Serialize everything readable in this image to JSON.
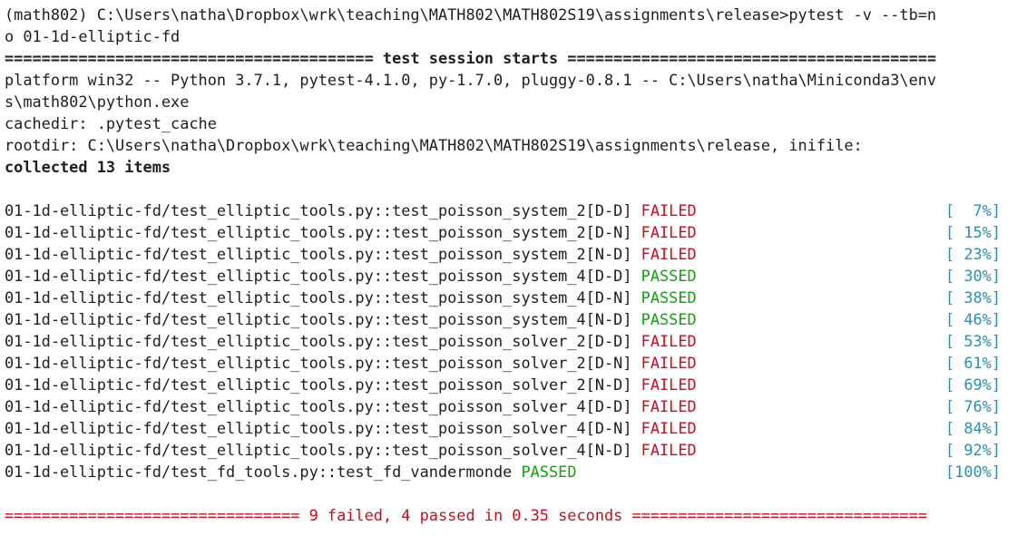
{
  "terminal": {
    "command_line_1": "(math802) C:\\Users\\natha\\Dropbox\\wrk\\teaching\\MATH802\\MATH802S19\\assignments\\release>pytest -v --tb=n",
    "command_line_2": "o 01-1d-elliptic-fd",
    "session_banner": "======================================== test session starts ========================================",
    "platform_line_1": "platform win32 -- Python 3.7.1, pytest-4.1.0, py-1.7.0, pluggy-0.8.1 -- C:\\Users\\natha\\Miniconda3\\env",
    "platform_line_2": "s\\math802\\python.exe",
    "cachedir_line": "cachedir: .pytest_cache",
    "rootdir_line": "rootdir: C:\\Users\\natha\\Dropbox\\wrk\\teaching\\MATH802\\MATH802S19\\assignments\\release, inifile:",
    "collected_line": "collected 13 items",
    "tests": [
      {
        "name": "01-1d-elliptic-fd/test_elliptic_tools.py::test_poisson_system_2[D-D]",
        "status": "FAILED",
        "progress": "[  7%]"
      },
      {
        "name": "01-1d-elliptic-fd/test_elliptic_tools.py::test_poisson_system_2[D-N]",
        "status": "FAILED",
        "progress": "[ 15%]"
      },
      {
        "name": "01-1d-elliptic-fd/test_elliptic_tools.py::test_poisson_system_2[N-D]",
        "status": "FAILED",
        "progress": "[ 23%]"
      },
      {
        "name": "01-1d-elliptic-fd/test_elliptic_tools.py::test_poisson_system_4[D-D]",
        "status": "PASSED",
        "progress": "[ 30%]"
      },
      {
        "name": "01-1d-elliptic-fd/test_elliptic_tools.py::test_poisson_system_4[D-N]",
        "status": "PASSED",
        "progress": "[ 38%]"
      },
      {
        "name": "01-1d-elliptic-fd/test_elliptic_tools.py::test_poisson_system_4[N-D]",
        "status": "PASSED",
        "progress": "[ 46%]"
      },
      {
        "name": "01-1d-elliptic-fd/test_elliptic_tools.py::test_poisson_solver_2[D-D]",
        "status": "FAILED",
        "progress": "[ 53%]"
      },
      {
        "name": "01-1d-elliptic-fd/test_elliptic_tools.py::test_poisson_solver_2[D-N]",
        "status": "FAILED",
        "progress": "[ 61%]"
      },
      {
        "name": "01-1d-elliptic-fd/test_elliptic_tools.py::test_poisson_solver_2[N-D]",
        "status": "FAILED",
        "progress": "[ 69%]"
      },
      {
        "name": "01-1d-elliptic-fd/test_elliptic_tools.py::test_poisson_solver_4[D-D]",
        "status": "FAILED",
        "progress": "[ 76%]"
      },
      {
        "name": "01-1d-elliptic-fd/test_elliptic_tools.py::test_poisson_solver_4[D-N]",
        "status": "FAILED",
        "progress": "[ 84%]"
      },
      {
        "name": "01-1d-elliptic-fd/test_elliptic_tools.py::test_poisson_solver_4[N-D]",
        "status": "FAILED",
        "progress": "[ 92%]"
      },
      {
        "name": "01-1d-elliptic-fd/test_fd_tools.py::test_fd_vandermonde",
        "status": "PASSED",
        "progress": "[100%]"
      }
    ],
    "summary_line": "================================ 9 failed, 4 passed in 0.35 seconds ================================"
  },
  "colors": {
    "background": "#ffffff",
    "text": "#1e1e1e",
    "failed": "#c50f1f",
    "passed": "#13a10e",
    "progress": "#2f8fb3"
  }
}
